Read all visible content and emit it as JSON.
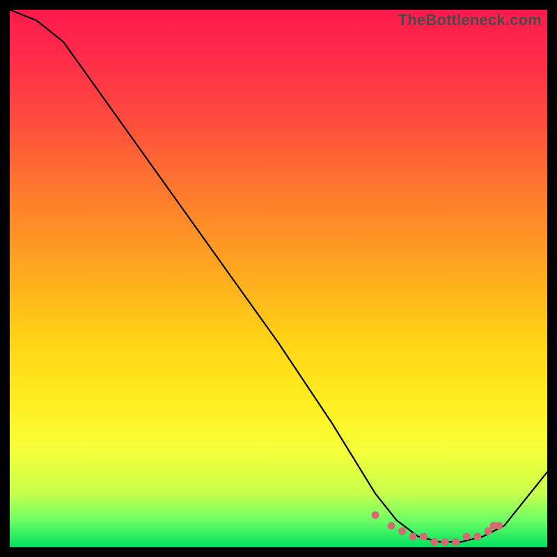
{
  "watermark": "TheBottleneck.com",
  "chart_data": {
    "type": "line",
    "title": "",
    "xlabel": "",
    "ylabel": "",
    "xlim": [
      0,
      100
    ],
    "ylim": [
      0,
      100
    ],
    "x": [
      0,
      5,
      10,
      20,
      30,
      40,
      50,
      60,
      68,
      72,
      76,
      80,
      84,
      88,
      92,
      100
    ],
    "values": [
      100,
      98,
      94,
      80,
      66,
      52,
      38,
      23,
      10,
      5,
      2,
      1,
      1,
      2,
      4,
      14
    ],
    "markers": {
      "x": [
        68,
        71,
        73,
        75,
        77,
        79,
        81,
        83,
        85,
        87,
        89,
        90,
        91
      ],
      "values": [
        6,
        4,
        3,
        2,
        2,
        1,
        1,
        1,
        2,
        2,
        3,
        4,
        4
      ]
    },
    "line_color": "#000000",
    "marker_color": "#d56a72"
  }
}
